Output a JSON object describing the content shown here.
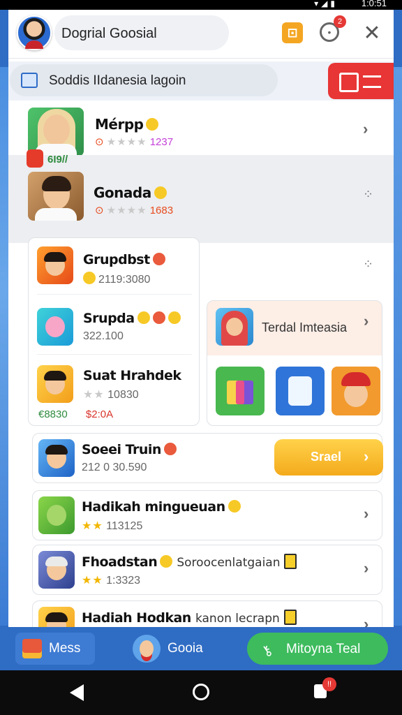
{
  "status": {
    "time": "1:0:51"
  },
  "header": {
    "title": "Dogrial Goosial",
    "notification_count": "2",
    "icons": [
      "avatar",
      "note-icon",
      "clock-icon",
      "close-icon"
    ]
  },
  "search": {
    "placeholder": "Soddis IIdanesia lagoin"
  },
  "rows": [
    {
      "name": "Mérpp",
      "prefix": "⊙",
      "stars": "★★★★",
      "number": "1237"
    },
    {
      "name": "Gonada",
      "prefix": "⊙",
      "stars": "★★★★",
      "number": "1683"
    }
  ],
  "sticker_text": "6I9//",
  "group_card": {
    "items": [
      {
        "name": "Grupdbst",
        "meta": "2119:3080"
      },
      {
        "name": "Srupda",
        "meta": "322.100"
      },
      {
        "name": "Suat Hrahdek",
        "stars": "★★",
        "meta": "10830"
      }
    ],
    "footer_green": "€8830",
    "footer_red": "$2:0A"
  },
  "featured": {
    "label": "Terdal Imteasia"
  },
  "list_items": [
    {
      "name": "Soeei Truin",
      "meta": "212 0 30.590",
      "button": "Srael"
    },
    {
      "name": "Hadikah mingueuan",
      "stars": "★★",
      "meta": "113125"
    },
    {
      "name": "Fhoadstan",
      "sub": "Soroocenlatgaian",
      "stars": "★★",
      "meta": "1:3323"
    },
    {
      "name": "Hadiah Hodkan",
      "sub": "kanon lecrapn"
    }
  ],
  "bottom_nav": {
    "mess": "Mess",
    "social": "Gooia",
    "pill": "Mitoyna Teal"
  },
  "system_nav": {
    "badge": "!!"
  },
  "colors": {
    "accent_blue": "#2f6cc4",
    "accent_red": "#e83535",
    "accent_green": "#3dbb5d",
    "accent_yellow": "#f4aa1c"
  }
}
